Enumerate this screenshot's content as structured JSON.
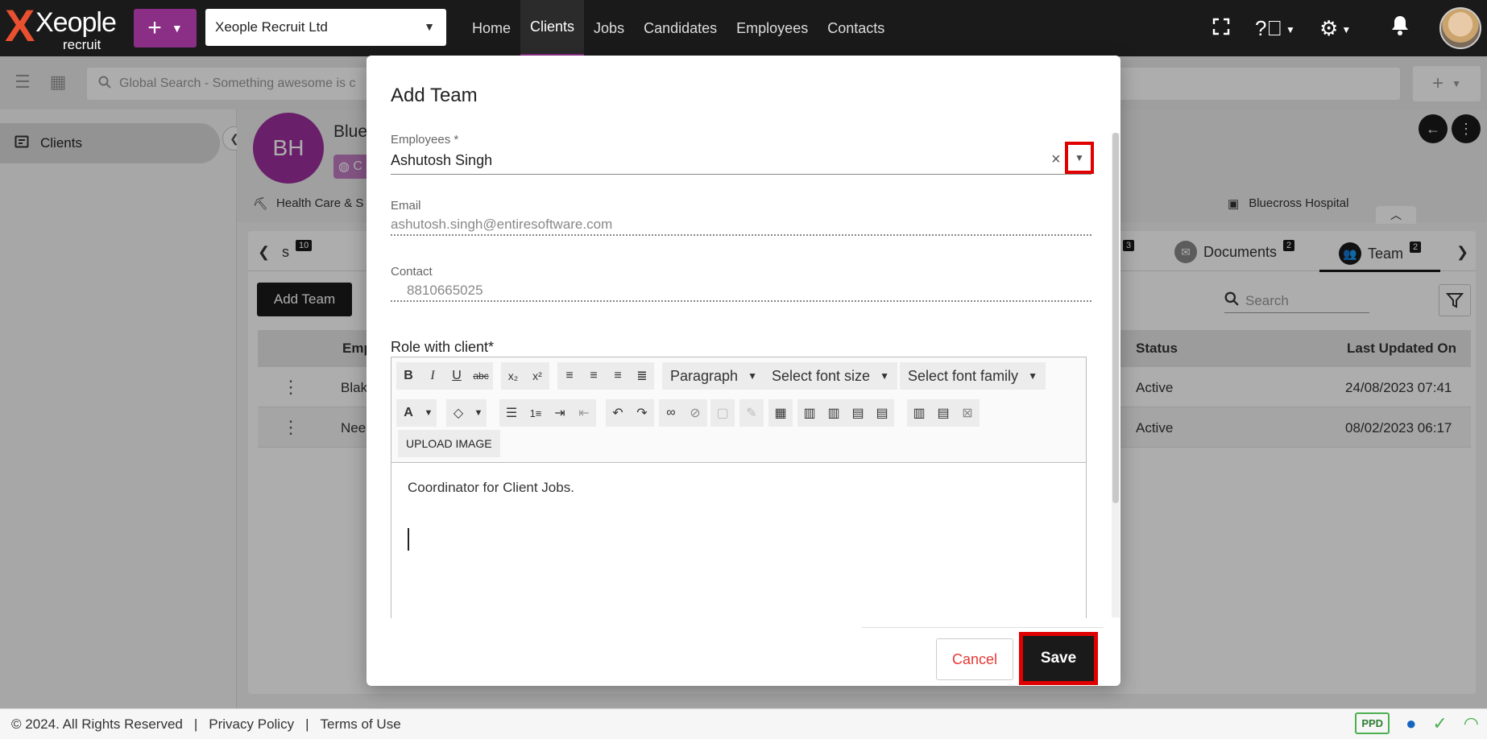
{
  "app": {
    "logo_name": "Xeople",
    "logo_sub": "recruit",
    "company": "Xeople Recruit Ltd"
  },
  "nav": {
    "items": [
      {
        "label": "Home"
      },
      {
        "label": "Clients"
      },
      {
        "label": "Jobs"
      },
      {
        "label": "Candidates"
      },
      {
        "label": "Employees"
      },
      {
        "label": "Contacts"
      }
    ],
    "active": "Clients"
  },
  "search": {
    "placeholder": "Global Search - Something awesome is c"
  },
  "sidebar": {
    "items": [
      {
        "label": "Clients"
      }
    ]
  },
  "client": {
    "initials": "BH",
    "name": "Blue",
    "chip": "C",
    "industry": "Health Care & S",
    "hospital": "Bluecross Hospital"
  },
  "tabs": [
    {
      "label": "s",
      "badge": "10"
    },
    {
      "label": "",
      "badge": "3"
    },
    {
      "label": "Documents",
      "badge": "2"
    },
    {
      "label": "Team",
      "badge": "2"
    }
  ],
  "team": {
    "add_label": "Add Team",
    "search_placeholder": "Search",
    "columns": [
      "Emp",
      "Status",
      "Last Updated On"
    ],
    "rows": [
      {
        "name": "Blake",
        "status": "Active",
        "updated": "24/08/2023 07:41"
      },
      {
        "name": "Neela",
        "status": "Active",
        "updated": "08/02/2023 06:17"
      }
    ]
  },
  "modal": {
    "title": "Add Team",
    "employees_label": "Employees *",
    "employees_value": "Ashutosh Singh",
    "clear_glyph": "×",
    "email_label": "Email",
    "email_value": "ashutosh.singh@entiresoftware.com",
    "contact_label": "Contact",
    "contact_value": "8810665025",
    "role_label": "Role with client*",
    "editor": {
      "paragraph": "Paragraph",
      "font_size": "Select font size",
      "font_family": "Select font family",
      "upload": "UPLOAD IMAGE",
      "content": "Coordinator for Client Jobs."
    },
    "cancel": "Cancel",
    "save": "Save"
  },
  "footer": {
    "copyright": "© 2024. All Rights Reserved",
    "privacy": "Privacy Policy",
    "terms": "Terms of Use",
    "ppd": "PPD"
  },
  "colors": {
    "brand": "#8b2e86",
    "highlight": "#e00000",
    "cancel": "#e53935"
  }
}
